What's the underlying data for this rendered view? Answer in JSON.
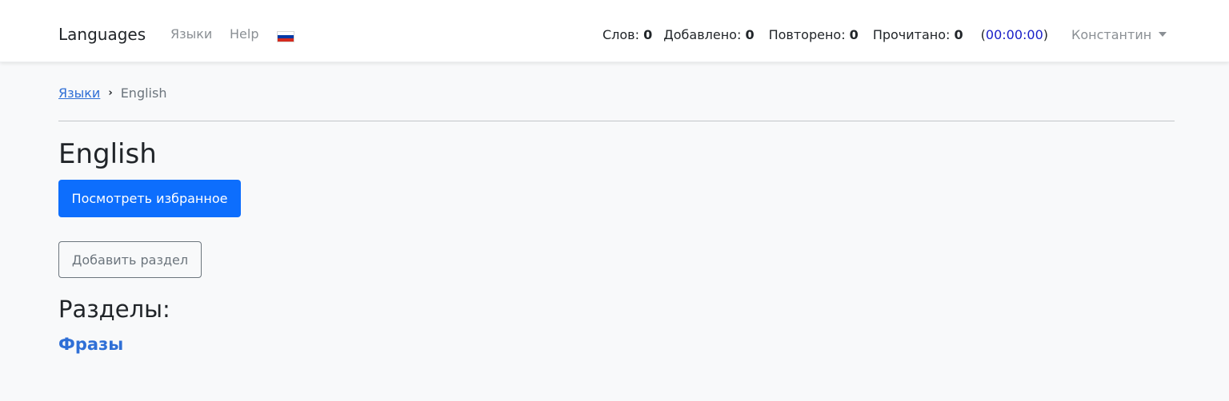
{
  "navbar": {
    "brand": "Languages",
    "links": [
      "Языки",
      "Help"
    ],
    "flag": {
      "name": "russia-flag-icon",
      "colors": [
        "#ffffff",
        "#0039a6",
        "#d52b1e"
      ]
    },
    "stats": [
      {
        "label": "Слов:",
        "value": "0"
      },
      {
        "label": "Добавлено:",
        "value": "0"
      },
      {
        "label": "Повторено:",
        "value": "0"
      },
      {
        "label": "Прочитано:",
        "value": "0"
      }
    ],
    "timer": {
      "open": "(",
      "value": "00:00:00",
      "close": ")"
    },
    "user": "Константин"
  },
  "breadcrumb": {
    "link": "Языки",
    "separator": "›",
    "current": "English"
  },
  "main": {
    "title": "English",
    "favorites_button": "Посмотреть избранное",
    "add_section_button": "Добавить раздел",
    "sections_heading": "Разделы:",
    "sections": [
      "Фразы"
    ]
  },
  "colors": {
    "primary": "#0d6efd",
    "link": "#2f6fd6",
    "timer": "#1a20c8"
  }
}
